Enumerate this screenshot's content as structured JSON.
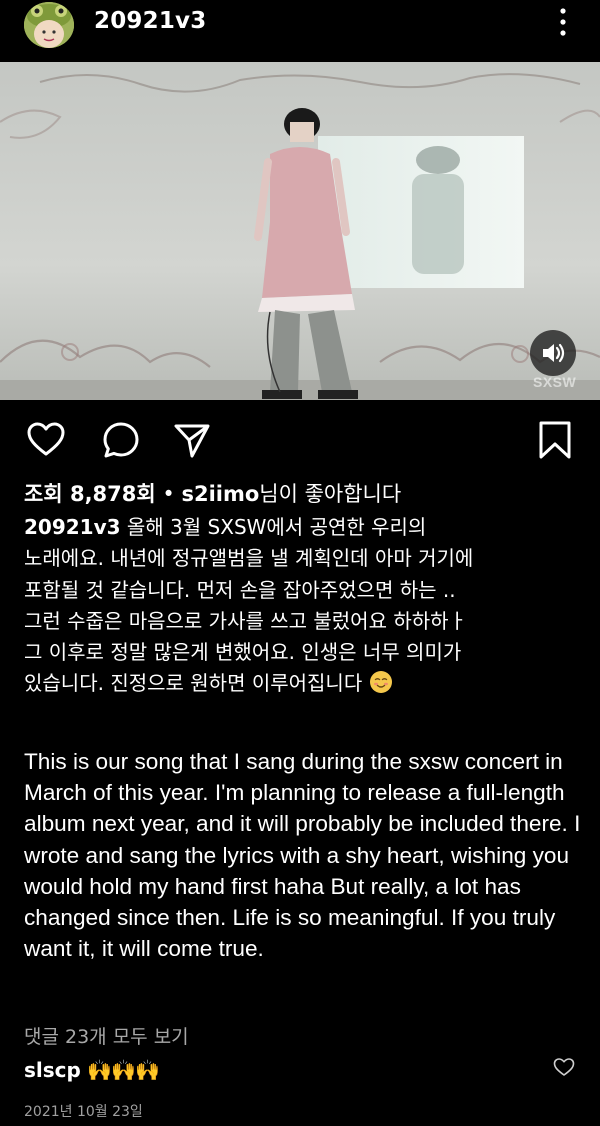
{
  "header": {
    "username": "20921v3",
    "avatar_icon": "avatar-frog-hat",
    "more_icon": "more-vertical-icon"
  },
  "video": {
    "watermark": "SXSW",
    "sound_icon": "speaker-icon",
    "background_color": "#c9cbc8"
  },
  "actions": {
    "like_icon": "heart-icon",
    "comment_icon": "comment-icon",
    "share_icon": "send-icon",
    "save_icon": "bookmark-icon"
  },
  "likes": {
    "views": "조회 8,878회",
    "separator": " • ",
    "liked_by": "s2iimo",
    "liked_suffix": "님이 좋아합니다"
  },
  "caption": {
    "username": "20921v3",
    "text_ko": " 올해 3월 SXSW에서 공연한 우리의\n노래에요. 내년에 정규앨범을 낼 계획인데 아마 거기에\n포함될 것 같습니다. 먼저 손을 잡아주었으면 하는 ..\n그런 수줍은 마음으로 가사를 쓰고 불렀어요 하하하ㅏ\n그 이후로 정말 많은게 변했어요. 인생은 너무 의미가\n있습니다. 진정으로 원하면 이루어집니다 ",
    "emoji": "smiling-face-emoji",
    "text_en": "This is our song that I sang during the sxsw concert in March of this year. I'm planning to release a full-length album next year, and it will probably be included there. I wrote and sang the lyrics with a shy heart, wishing you would hold my hand first haha But really, a lot has changed since then. Life is so meaningful. If you truly want it, it will come true."
  },
  "comments": {
    "view_all": "댓글 23개 모두 보기",
    "top_comment": {
      "username": "slscp",
      "text": "🙌🙌🙌",
      "heart_icon": "heart-outline-icon"
    }
  },
  "date": "2021년 10월 23일"
}
